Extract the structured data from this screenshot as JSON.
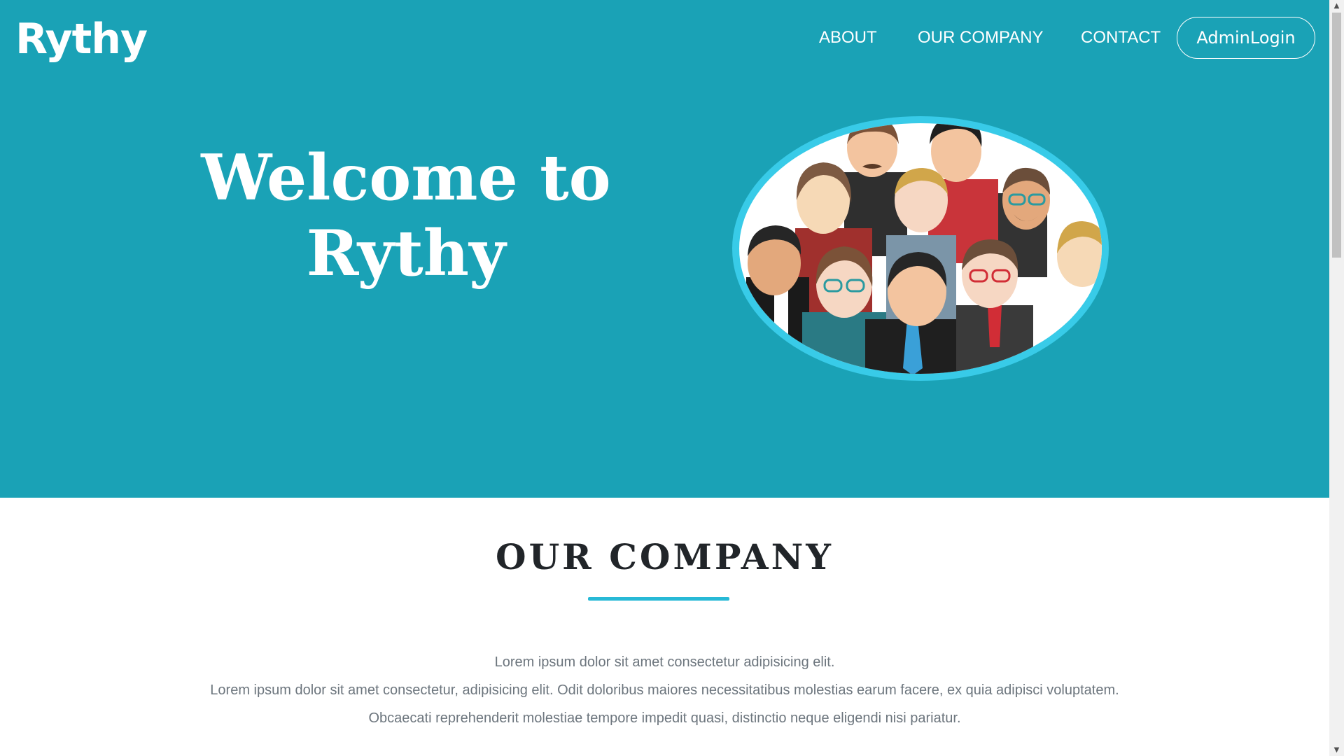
{
  "brand": {
    "logo_text": "Rythy"
  },
  "nav": {
    "about": "ABOUT",
    "company": "OUR COMPANY",
    "contact": "CONTACT",
    "admin_login": "AdminLogin"
  },
  "hero": {
    "headline_line1": "Welcome to",
    "headline_line2": "Rythy",
    "image_icon": "team-people-illustration"
  },
  "company": {
    "title": "OUR COMPANY",
    "lines": [
      "Lorem ipsum dolor sit amet consectetur adipisicing elit.",
      "Lorem ipsum dolor sit amet consectetur, adipisicing elit. Odit doloribus maiores necessitatibus molestias earum facere, ex quia adipisci voluptatem.",
      "Obcaecati reprehenderit molestiae tempore impedit quasi, distinctio neque eligendi nisi pariatur."
    ]
  },
  "colors": {
    "hero_bg": "#1aa2b6",
    "accent": "#27b9d6",
    "heading": "#212529",
    "body_text": "#6c757d"
  }
}
